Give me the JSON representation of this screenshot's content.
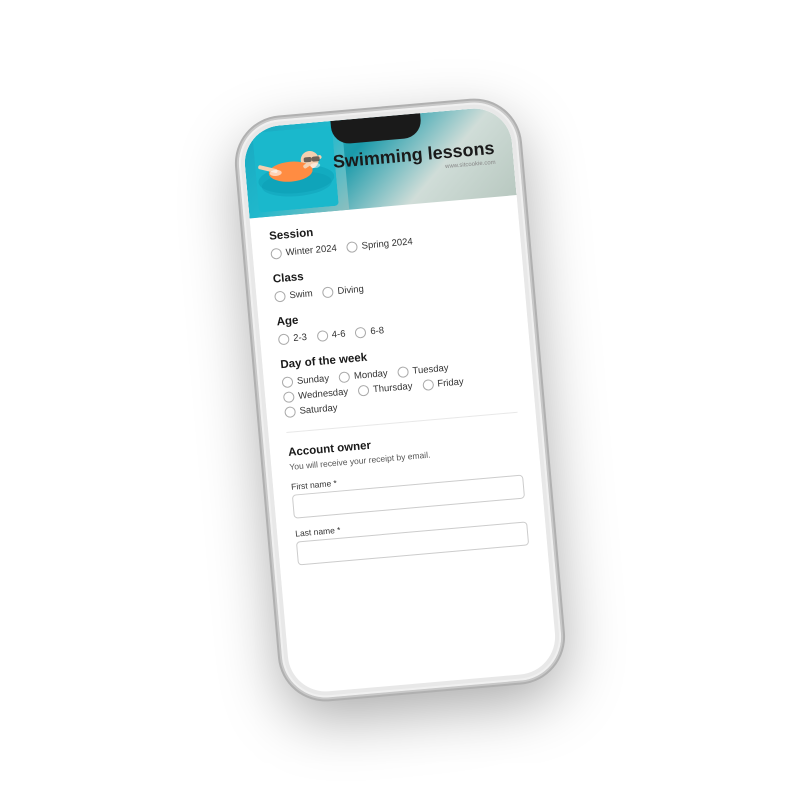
{
  "app": {
    "title": "Swimming lessons",
    "website": "www.sitcookie.com"
  },
  "form": {
    "session": {
      "label": "Session",
      "options": [
        {
          "id": "winter2024",
          "label": "Winter 2024",
          "checked": false
        },
        {
          "id": "spring2024",
          "label": "Spring 2024",
          "checked": false
        }
      ]
    },
    "class": {
      "label": "Class",
      "options": [
        {
          "id": "swim",
          "label": "Swim",
          "checked": false
        },
        {
          "id": "diving",
          "label": "Diving",
          "checked": false
        }
      ]
    },
    "age": {
      "label": "Age",
      "options": [
        {
          "id": "age2-3",
          "label": "2-3",
          "checked": false
        },
        {
          "id": "age4-6",
          "label": "4-6",
          "checked": false
        },
        {
          "id": "age6-8",
          "label": "6-8",
          "checked": false
        }
      ]
    },
    "day": {
      "label": "Day of the week",
      "row1": [
        {
          "id": "sunday",
          "label": "Sunday",
          "checked": false
        },
        {
          "id": "monday",
          "label": "Monday",
          "checked": false
        },
        {
          "id": "tuesday",
          "label": "Tuesday",
          "checked": false
        }
      ],
      "row2": [
        {
          "id": "wednesday",
          "label": "Wednesday",
          "checked": false
        },
        {
          "id": "thursday",
          "label": "Thursday",
          "checked": false
        },
        {
          "id": "friday",
          "label": "Friday",
          "checked": false
        }
      ],
      "row3": [
        {
          "id": "saturday",
          "label": "Saturday",
          "checked": false
        }
      ]
    },
    "account": {
      "title": "Account owner",
      "subtitle": "You will receive your receipt by email.",
      "fields": [
        {
          "id": "first-name",
          "label": "First name *",
          "value": ""
        },
        {
          "id": "last-name",
          "label": "Last name *",
          "value": ""
        }
      ]
    }
  }
}
